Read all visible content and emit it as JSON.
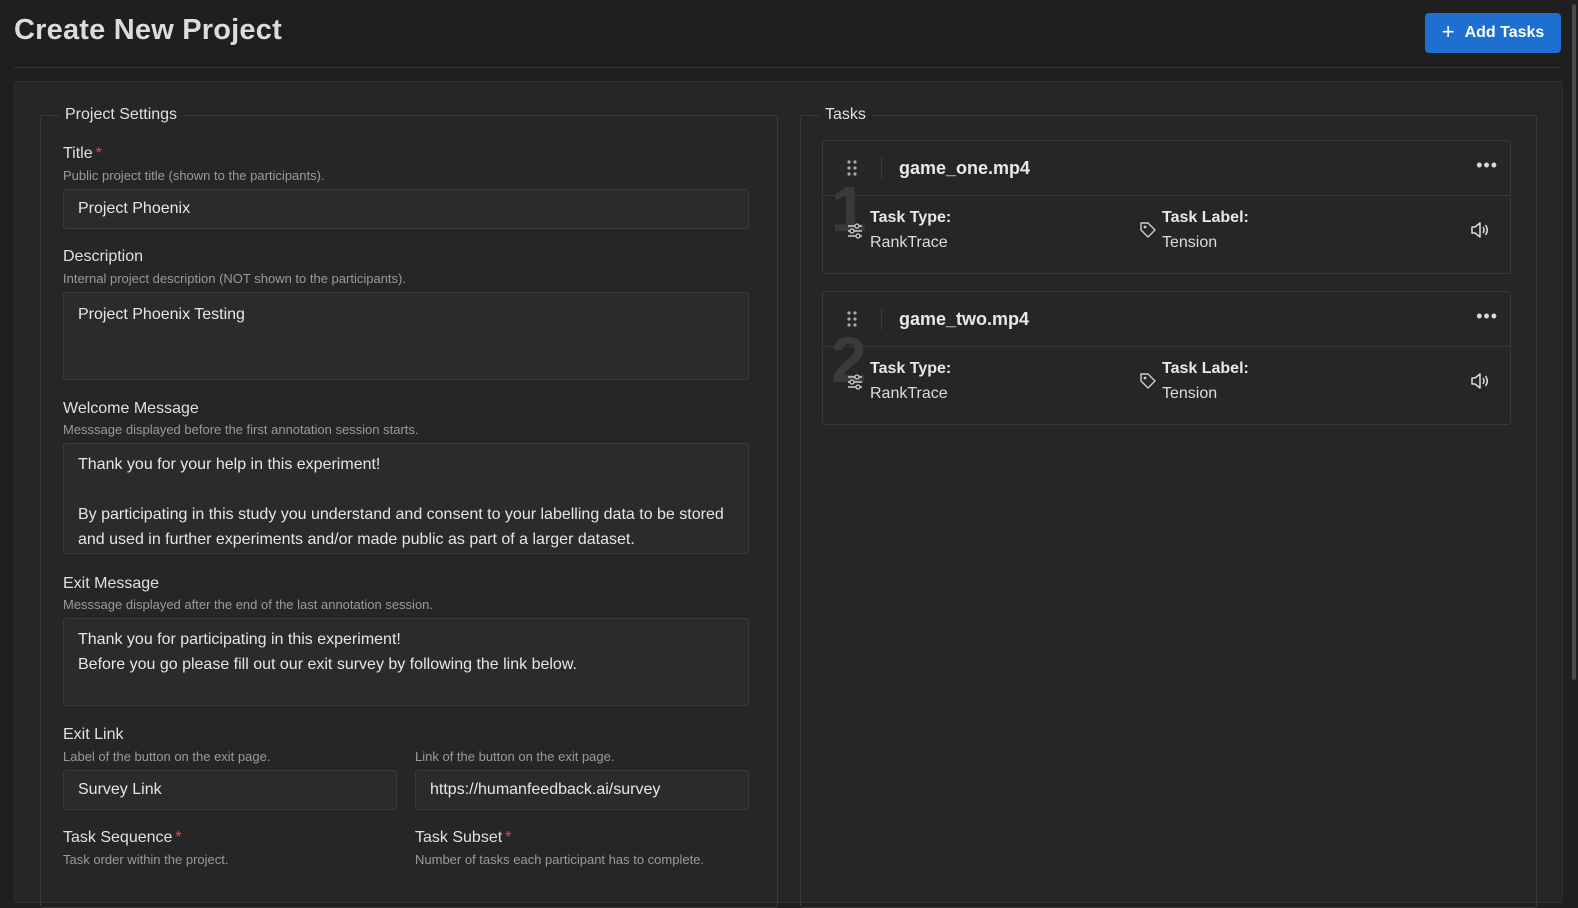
{
  "header": {
    "title": "Create New Project",
    "add_tasks_label": "Add Tasks",
    "add_tasks_icon": "plus-icon"
  },
  "settings": {
    "legend": "Project Settings",
    "title": {
      "label": "Title",
      "required_mark": "*",
      "hint": "Public project title (shown to the participants).",
      "value": "Project Phoenix"
    },
    "description": {
      "label": "Description",
      "hint": "Internal project description (NOT shown to the participants).",
      "value": "Project Phoenix Testing"
    },
    "welcome": {
      "label": "Welcome Message",
      "hint": "Messsage displayed before the first annotation session starts.",
      "lines": [
        "Thank you for your help in this experiment!",
        "",
        "By participating in this study you understand and consent to your labelling data to be stored",
        "and used in further experiments and/or made public as part of a larger dataset."
      ]
    },
    "exit": {
      "label": "Exit Message",
      "hint": "Messsage displayed after the end of the last annotation session.",
      "lines": [
        "Thank you for participating in this experiment!",
        "Before you go please fill out our exit survey by following the link below."
      ]
    },
    "exit_link": {
      "label": "Exit Link",
      "label_hint": "Label of the button on the exit page.",
      "label_value": "Survey Link",
      "link_hint": "Link of the button on the exit page.",
      "link_value": "https://humanfeedback.ai/survey"
    },
    "task_sequence": {
      "label": "Task Sequence",
      "required_mark": "*",
      "hint": "Task order within the project."
    },
    "task_subset": {
      "label": "Task Subset",
      "required_mark": "*",
      "hint": "Number of tasks each participant has to complete."
    }
  },
  "tasks": {
    "legend": "Tasks",
    "type_label": "Task Type:",
    "label_label": "Task Label:",
    "items": [
      {
        "number": "1",
        "name": "game_one.mp4",
        "type": "RankTrace",
        "label": "Tension"
      },
      {
        "number": "2",
        "name": "game_two.mp4",
        "type": "RankTrace",
        "label": "Tension"
      }
    ]
  },
  "colors": {
    "accent": "#1d6fd0",
    "background": "#1f1f1f",
    "required": "#e14c4c"
  }
}
